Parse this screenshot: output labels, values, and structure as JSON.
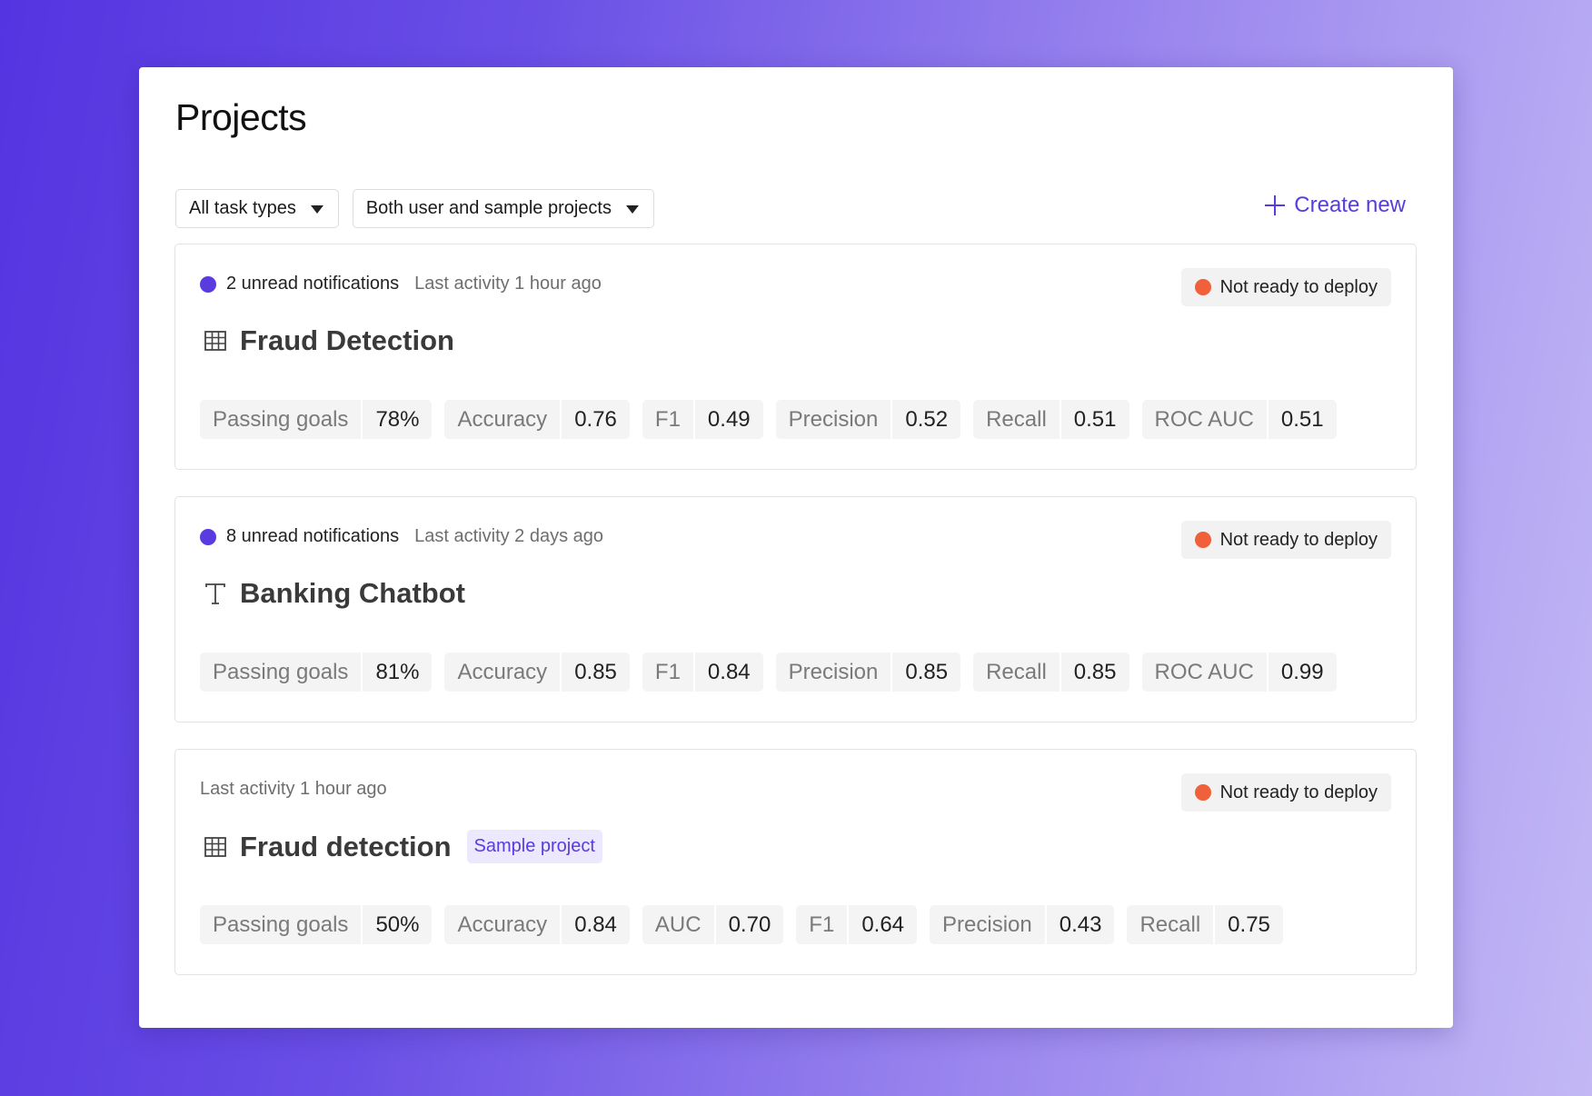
{
  "page": {
    "title": "Projects"
  },
  "filters": {
    "task_types": "All task types",
    "project_scope": "Both user and sample projects"
  },
  "actions": {
    "create_new": "Create new"
  },
  "colors": {
    "accent": "#5a3be0",
    "not_ready": "#f0603a",
    "sample_tag_bg": "#ece8fd"
  },
  "projects": [
    {
      "notifications": "2 unread notifications",
      "activity": "Last activity 1 hour ago",
      "status": "Not ready to deploy",
      "name": "Fraud Detection",
      "type_icon": "table-icon",
      "metrics": [
        {
          "label": "Passing goals",
          "value": "78%"
        },
        {
          "label": "Accuracy",
          "value": "0.76"
        },
        {
          "label": "F1",
          "value": "0.49"
        },
        {
          "label": "Precision",
          "value": "0.52"
        },
        {
          "label": "Recall",
          "value": "0.51"
        },
        {
          "label": "ROC AUC",
          "value": "0.51"
        }
      ]
    },
    {
      "notifications": "8 unread notifications",
      "activity": "Last activity 2 days ago",
      "status": "Not ready to deploy",
      "name": "Banking Chatbot",
      "type_icon": "text-icon",
      "metrics": [
        {
          "label": "Passing goals",
          "value": "81%"
        },
        {
          "label": "Accuracy",
          "value": "0.85"
        },
        {
          "label": "F1",
          "value": "0.84"
        },
        {
          "label": "Precision",
          "value": "0.85"
        },
        {
          "label": "Recall",
          "value": "0.85"
        },
        {
          "label": "ROC AUC",
          "value": "0.99"
        }
      ]
    },
    {
      "activity": "Last activity 1 hour ago",
      "status": "Not ready to deploy",
      "name": "Fraud detection",
      "tag": "Sample project",
      "type_icon": "table-icon",
      "metrics": [
        {
          "label": "Passing goals",
          "value": "50%"
        },
        {
          "label": "Accuracy",
          "value": "0.84"
        },
        {
          "label": "AUC",
          "value": "0.70"
        },
        {
          "label": "F1",
          "value": "0.64"
        },
        {
          "label": "Precision",
          "value": "0.43"
        },
        {
          "label": "Recall",
          "value": "0.75"
        }
      ]
    }
  ]
}
